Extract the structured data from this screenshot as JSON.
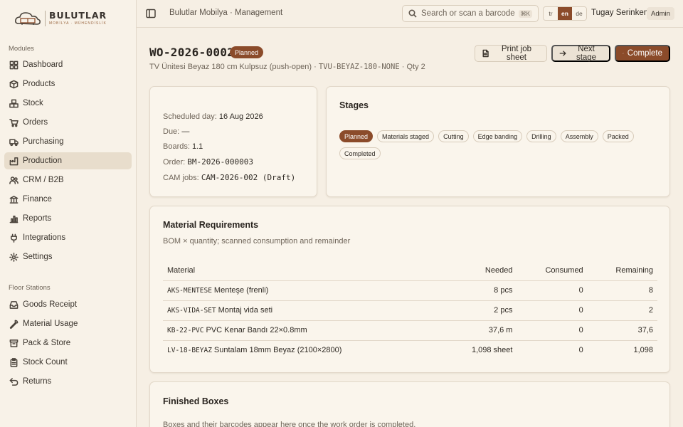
{
  "brand": {
    "name": "BULUTLAR",
    "tagline": "MOBİLYA · MÜHENDİSLİK"
  },
  "sidebar": {
    "modules_label": "Modules",
    "modules": [
      {
        "label": "Dashboard",
        "icon": "dashboard-icon"
      },
      {
        "label": "Products",
        "icon": "box-icon"
      },
      {
        "label": "Stock",
        "icon": "boxes-icon"
      },
      {
        "label": "Orders",
        "icon": "cart-icon"
      },
      {
        "label": "Purchasing",
        "icon": "truck-icon"
      },
      {
        "label": "Production",
        "icon": "factory-icon",
        "active": true
      },
      {
        "label": "CRM / B2B",
        "icon": "users-icon"
      },
      {
        "label": "Finance",
        "icon": "bank-icon"
      },
      {
        "label": "Reports",
        "icon": "bar-chart-icon"
      },
      {
        "label": "Integrations",
        "icon": "plug-icon"
      },
      {
        "label": "Settings",
        "icon": "gear-icon"
      }
    ],
    "floor_label": "Floor Stations",
    "floor": [
      {
        "label": "Goods Receipt",
        "icon": "inbox-icon"
      },
      {
        "label": "Material Usage",
        "icon": "wrench-icon"
      },
      {
        "label": "Pack & Store",
        "icon": "archive-icon"
      },
      {
        "label": "Stock Count",
        "icon": "clipboard-icon"
      },
      {
        "label": "Returns",
        "icon": "undo-icon"
      }
    ]
  },
  "topbar": {
    "breadcrumb": "Bulutlar Mobilya · Management",
    "search_placeholder": "Search or scan a barcode",
    "search_shortcut": "⌘K",
    "languages": [
      "tr",
      "en",
      "de"
    ],
    "active_language": "en",
    "user_name": "Tugay Serinken",
    "user_role": "Admin"
  },
  "work_order": {
    "code": "WO-2026-0002",
    "status": "Planned",
    "product_name": "TV Ünitesi Beyaz 180 cm Kulpsuz (push-open)",
    "product_sku": "TVU-BEYAZ-180-NONE",
    "qty": "Qty 2",
    "actions": {
      "print": "Print job sheet",
      "next": "Next stage",
      "complete": "Complete"
    }
  },
  "info": {
    "scheduled_label": "Scheduled day:",
    "scheduled_value": "16 Aug 2026",
    "due_label": "Due:",
    "due_value": "—",
    "boards_label": "Boards:",
    "boards_value": "1.1",
    "order_label": "Order:",
    "order_value": "BM-2026-000003",
    "cam_label": "CAM jobs:",
    "cam_value": "CAM-2026-002 (Draft)"
  },
  "stages": {
    "title": "Stages",
    "current": "Planned",
    "items": [
      "Planned",
      "Materials staged",
      "Cutting",
      "Edge banding",
      "Drilling",
      "Assembly",
      "Packed",
      "Completed"
    ]
  },
  "materials": {
    "title": "Material Requirements",
    "description": "BOM × quantity; scanned consumption and remainder",
    "columns": [
      "Material",
      "Needed",
      "Consumed",
      "Remaining"
    ],
    "rows": [
      {
        "sku": "AKS-MENTESE",
        "name": "Menteşe (frenli)",
        "needed": "8 pcs",
        "consumed": "0",
        "remaining": "8"
      },
      {
        "sku": "AKS-VIDA-SET",
        "name": "Montaj vida seti",
        "needed": "2 pcs",
        "consumed": "0",
        "remaining": "2"
      },
      {
        "sku": "KB-22-PVC",
        "name": "PVC Kenar Bandı 22×0.8mm",
        "needed": "37,6 m",
        "consumed": "0",
        "remaining": "37,6"
      },
      {
        "sku": "LV-18-BEYAZ",
        "name": "Suntalam 18mm Beyaz (2100×2800)",
        "needed": "1,098 sheet",
        "consumed": "0",
        "remaining": "1,098"
      }
    ]
  },
  "boxes": {
    "title": "Finished Boxes",
    "description": "Boxes and their barcodes appear here once the work order is completed."
  },
  "colors": {
    "accent": "#8b4b2a",
    "background": "#f6efe4",
    "card": "#faf5ec"
  }
}
